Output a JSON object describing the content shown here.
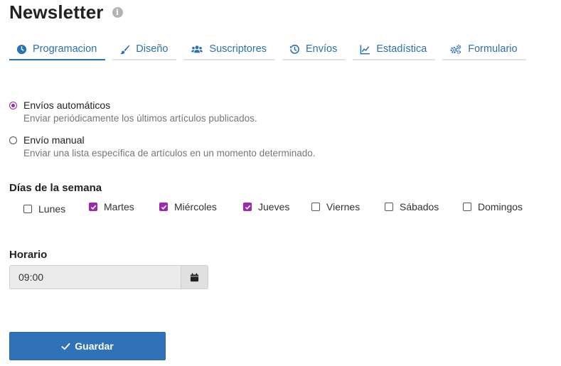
{
  "page": {
    "title": "Newsletter",
    "info_icon": "info-circle-icon"
  },
  "tabs": [
    {
      "label": "Programacion",
      "icon": "clock-icon",
      "active": true
    },
    {
      "label": "Diseño",
      "icon": "paint-brush-icon",
      "active": false
    },
    {
      "label": "Suscriptores",
      "icon": "users-icon",
      "active": false
    },
    {
      "label": "Envíos",
      "icon": "history-icon",
      "active": false
    },
    {
      "label": "Estadística",
      "icon": "line-chart-icon",
      "active": false
    },
    {
      "label": "Formulario",
      "icon": "cogs-icon",
      "active": false
    }
  ],
  "send_mode": {
    "options": [
      {
        "title": "Envíos automáticos",
        "description": "Enviar periódicamente los últimos artículos publicados.",
        "selected": true
      },
      {
        "title": "Envío manual",
        "description": "Enviar una lista específica de artículos en un momento determinado.",
        "selected": false
      }
    ]
  },
  "weekdays": {
    "label": "Días de la semana",
    "days": [
      {
        "label": "Lunes",
        "checked": false
      },
      {
        "label": "Martes",
        "checked": true
      },
      {
        "label": "Miércoles",
        "checked": true
      },
      {
        "label": "Jueves",
        "checked": true
      },
      {
        "label": "Viernes",
        "checked": false
      },
      {
        "label": "Sábados",
        "checked": false
      },
      {
        "label": "Domingos",
        "checked": false
      }
    ]
  },
  "schedule": {
    "label": "Horario",
    "time_value": "09:00",
    "calendar_icon": "calendar-icon"
  },
  "actions": {
    "save_label": "Guardar",
    "save_icon": "check-icon"
  },
  "colors": {
    "accent": "#2b70b0",
    "button": "#2f72b8",
    "checkbox_checked": "#9c27b0"
  }
}
